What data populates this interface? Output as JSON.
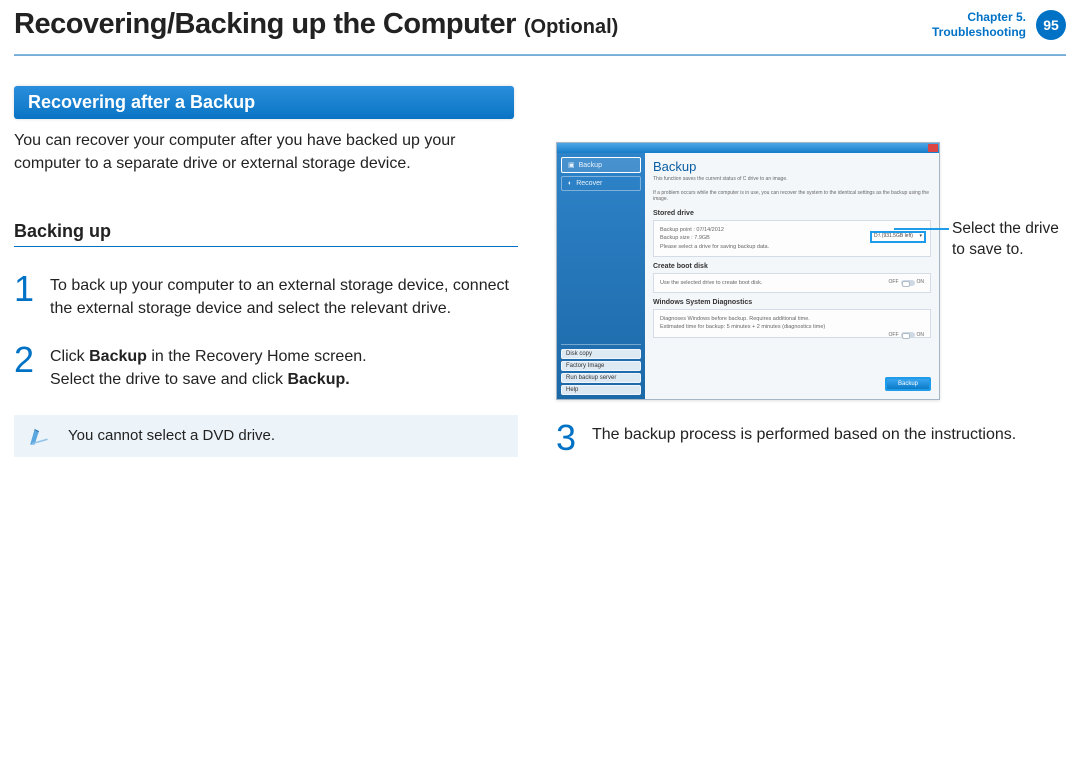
{
  "header": {
    "title": "Recovering/Backing up the Computer",
    "optional": "(Optional)",
    "chapter": "Chapter 5.",
    "chapter_sub": "Troubleshooting",
    "page_number": "95"
  },
  "section_title": "Recovering after a Backup",
  "intro": "You can recover your computer after you have backed up your computer to a separate drive or external storage device.",
  "subheading": "Backing up",
  "steps": {
    "n1": "1",
    "s1": "To back up your computer to an external storage device, connect the external storage device and select the relevant drive.",
    "n2": "2",
    "s2a": "Click ",
    "s2b": "Backup",
    "s2c": " in the Recovery Home screen.",
    "s2d": "Select the drive to save and click ",
    "s2e": "Backup.",
    "n3": "3",
    "s3": "The backup process is performed based on the instructions."
  },
  "note": "You cannot select a DVD drive.",
  "callout": "Select the drive to save to.",
  "screenshot": {
    "sidebar": {
      "backup": "Backup",
      "recover": "Recover",
      "disk_copy": "Disk copy",
      "factory_image": "Factory Image",
      "run_backup_server": "Run backup server",
      "help": "Help"
    },
    "main_title": "Backup",
    "desc1": "This function saves the current status of C drive to an image.",
    "desc2": "If a problem occurs while the computer is in use, you can recover the system to the identical settings as the backup using the image.",
    "stored_drive_title": "Stored drive",
    "backup_point_label": "Backup point : 07/14/2012",
    "backup_size_label": "Backup size : 7.9GB",
    "stored_drive_hint": "Please select a drive for saving backup data.",
    "drive_value": "D:\\ (931.5GB left)",
    "create_boot_title": "Create boot disk",
    "create_boot_text": "Use the selected drive to create boot disk.",
    "off": "OFF",
    "on": "ON",
    "wsd_title": "Windows System Diagnostics",
    "wsd_line1": "Diagnoses Windows before backup. Requires additional time.",
    "wsd_line2": "Estimated time for backup: 5 minutes + 2 minutes (diagnostics time)",
    "backup_btn": "Backup"
  }
}
